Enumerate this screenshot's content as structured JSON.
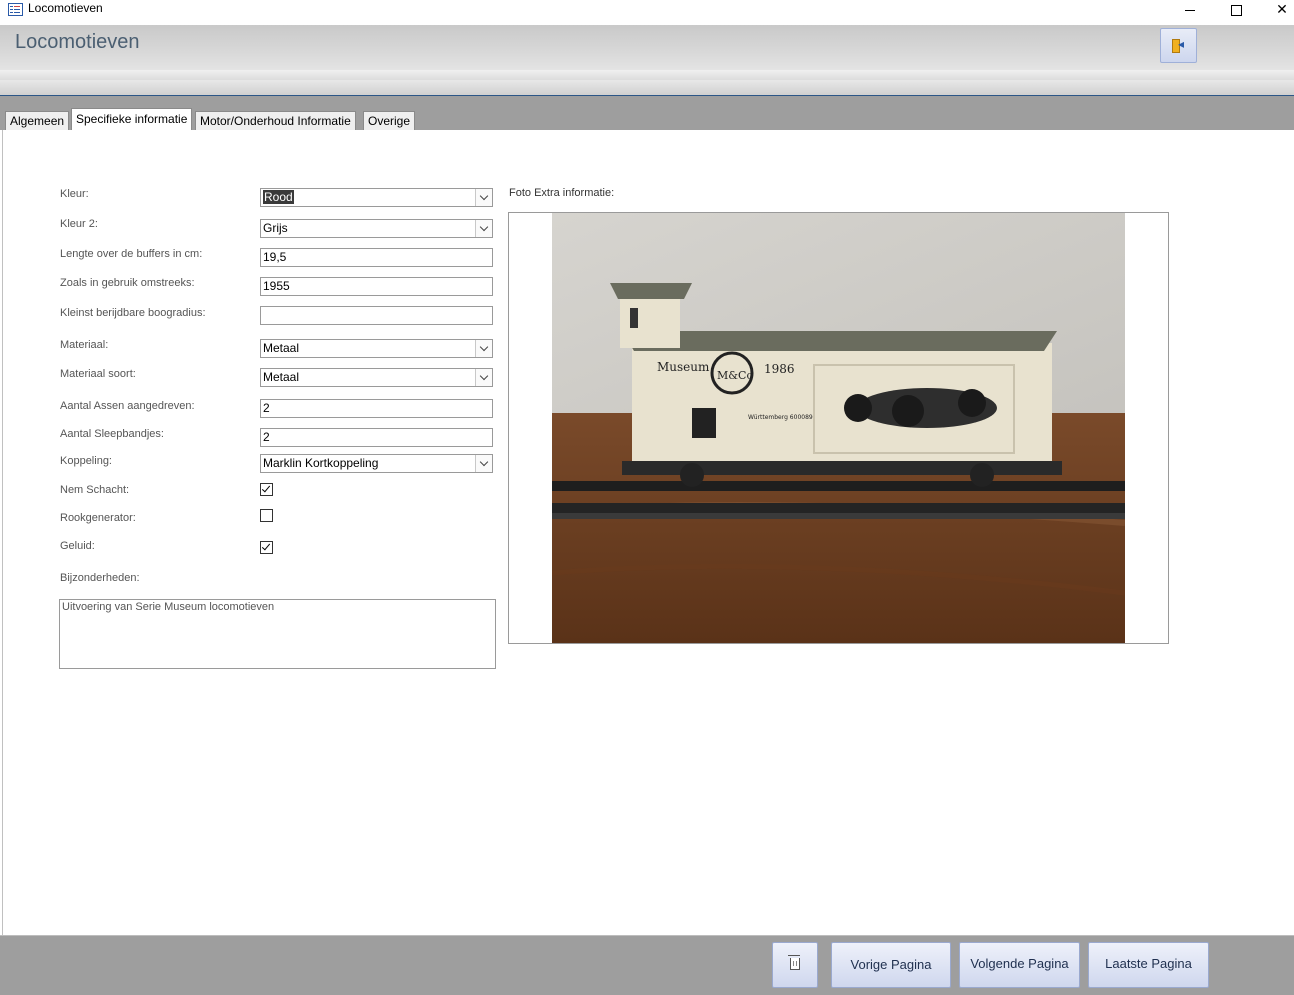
{
  "window": {
    "title": "Locomotieven",
    "min_icon": "minimize-icon",
    "max_icon": "maximize-icon",
    "close_icon": "close-icon",
    "close_glyph": "✕"
  },
  "header": {
    "title": "Locomotieven",
    "exit_icon": "exit-door-icon",
    "exit_glyph": "◂"
  },
  "tabs": [
    {
      "label": "Algemeen"
    },
    {
      "label": "Specifieke informatie"
    },
    {
      "label": "Motor/Onderhoud Informatie"
    },
    {
      "label": "Overige"
    }
  ],
  "form": {
    "kleur": {
      "label": "Kleur:",
      "value": "Rood"
    },
    "kleur2": {
      "label": "Kleur 2:",
      "value": "Grijs"
    },
    "lengte": {
      "label": "Lengte over de buffers in cm:",
      "value": "19,5"
    },
    "gebruik": {
      "label": "Zoals in gebruik omstreeks:",
      "value": "1955"
    },
    "boogradius": {
      "label": "Kleinst berijdbare boogradius:",
      "value": ""
    },
    "materiaal": {
      "label": "Materiaal:",
      "value": "Metaal"
    },
    "materiaal_soort": {
      "label": "Materiaal soort:",
      "value": "Metaal"
    },
    "assen": {
      "label": "Aantal Assen aangedreven:",
      "value": "2"
    },
    "sleepbandjes": {
      "label": "Aantal Sleepbandjes:",
      "value": "2"
    },
    "koppeling": {
      "label": "Koppeling:",
      "value": "Marklin Kortkoppeling"
    },
    "nem_schacht": {
      "label": "Nem Schacht:",
      "checked": true
    },
    "rookgenerator": {
      "label": "Rookgenerator:",
      "checked": false
    },
    "geluid": {
      "label": "Geluid:",
      "checked": true
    },
    "bijzonderheden": {
      "label": "Bijzonderheden:",
      "value": "Uitvoering van Serie Museum locomotieven"
    }
  },
  "photo": {
    "label": "Foto Extra informatie:",
    "wagon_text_left": "Museum",
    "wagon_text_right": "1986",
    "wagon_logo": "M&Co",
    "wagon_small": "Württemberg 600089"
  },
  "footer": {
    "delete_icon": "trash-icon",
    "prev": "Vorige Pagina",
    "next": "Volgende Pagina",
    "last": "Laatste Pagina"
  },
  "colors": {
    "accent_line": "#2c5687",
    "header_title": "#4b5f72",
    "button_bg": "#cfd7ee"
  }
}
